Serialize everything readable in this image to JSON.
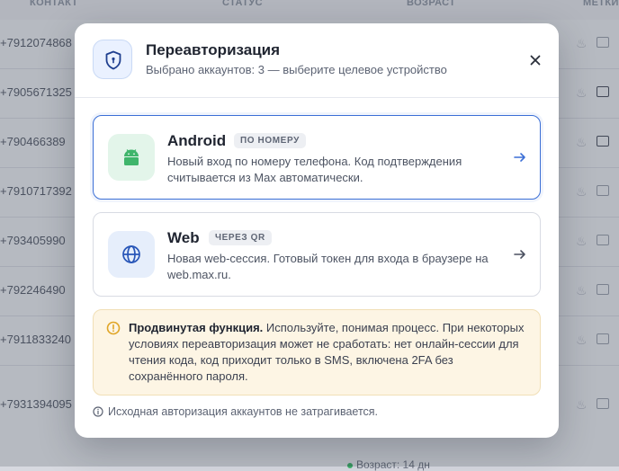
{
  "background": {
    "columns": [
      "КОНТАКТ",
      "СТАТУС",
      "ВОЗРАСТ",
      "МЕТКИ"
    ],
    "phones": [
      "+7912074868",
      "+7905671325",
      "+790466389",
      "+7910717392",
      "+793405990",
      "+792246490",
      "+7911833240",
      "+7931394095"
    ],
    "footer_status": "Возраст: 14 дн"
  },
  "modal": {
    "title": "Переавторизация",
    "subtitle": "Выбрано аккаунтов: 3 — выберите целевое устройство",
    "options": [
      {
        "name": "Android",
        "tag": "ПО НОМЕРУ",
        "description": "Новый вход по номеру телефона. Код подтверждения считывается из Max автоматически.",
        "selected": true,
        "icon": "android-icon"
      },
      {
        "name": "Web",
        "tag": "ЧЕРЕЗ QR",
        "description": "Новая web-сессия. Готовый токен для входа в браузере на web.max.ru.",
        "selected": false,
        "icon": "globe-icon"
      }
    ],
    "warning": {
      "title": "Продвинутая функция.",
      "text": " Используйте, понимая процесс. При некоторых условиях переавторизация может не сработать: нет онлайн-сессии для чтения кода, код приходит только в SMS, включена 2FA без сохранённого пароля."
    },
    "note": "Исходная авторизация аккаунтов не затрагивается."
  },
  "colors": {
    "accent": "#3b6fd6",
    "android": "#3fb56b",
    "warning_bg": "#fdf5e4",
    "warning_icon": "#e0a526"
  }
}
